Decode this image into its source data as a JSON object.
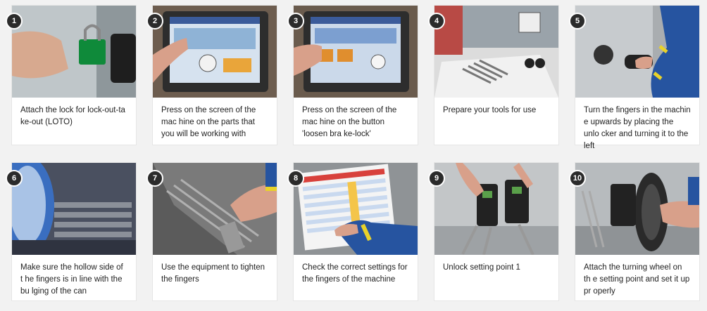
{
  "steps": [
    {
      "number": "1",
      "caption": "Attach the lock for lock-out-ta ke-out (LOTO)",
      "icon": "padlock-photo"
    },
    {
      "number": "2",
      "caption": "Press on the screen of the mac hine on the parts that you will be working with",
      "icon": "touchscreen-photo"
    },
    {
      "number": "3",
      "caption": "Press on the screen of the mac hine on the button 'loosen bra ke-lock'",
      "icon": "touchscreen-photo"
    },
    {
      "number": "4",
      "caption": "Prepare your tools for use",
      "icon": "tools-table-photo"
    },
    {
      "number": "5",
      "caption": "Turn the fingers in the machin e upwards by placing the unlo cker and turning it to the left",
      "icon": "machine-handle-photo"
    },
    {
      "number": "6",
      "caption": "Make sure the hollow side of t he fingers is in line with the bu lging of the can",
      "icon": "fingers-can-photo"
    },
    {
      "number": "7",
      "caption": "Use the equipment to tighten the fingers",
      "icon": "tightening-photo"
    },
    {
      "number": "8",
      "caption": "Check the correct settings for the fingers of the machine",
      "icon": "settings-sheet-photo"
    },
    {
      "number": "9",
      "caption": "Unlock setting point 1",
      "icon": "setting-point-photo"
    },
    {
      "number": "10",
      "caption": "Attach the turning wheel on th e setting point and set it up pr operly",
      "icon": "turning-wheel-photo"
    }
  ]
}
